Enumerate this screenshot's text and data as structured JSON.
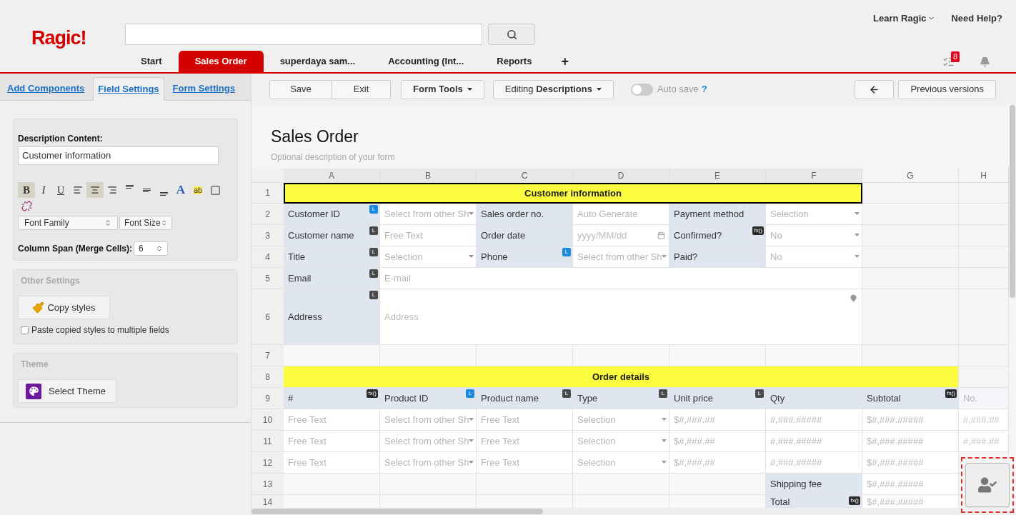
{
  "header": {
    "logo": "Ragic!",
    "links": [
      {
        "label": "Learn Ragic",
        "dropdown": true
      },
      {
        "label": "Need Help?",
        "dropdown": false
      }
    ],
    "task_count": "8"
  },
  "tabs": [
    {
      "label": "Start",
      "selected": false
    },
    {
      "label": "Sales Order",
      "selected": true
    },
    {
      "label": "superdaya sam...",
      "selected": false
    },
    {
      "label": "Accounting (Int...",
      "selected": false
    },
    {
      "label": "Reports",
      "selected": false
    }
  ],
  "add_tab": "+",
  "left_panel": {
    "tabs": [
      {
        "label": "Add Components",
        "selected": false
      },
      {
        "label": "Field Settings",
        "selected": true
      },
      {
        "label": "Form Settings",
        "selected": false
      }
    ],
    "description": {
      "label": "Description Content:",
      "value": "Customer information"
    },
    "format_buttons": [
      {
        "kind": "bold",
        "label": "B",
        "on": true
      },
      {
        "kind": "italic",
        "label": "I",
        "on": false
      },
      {
        "kind": "underline",
        "label": "U",
        "on": false
      },
      {
        "kind": "align-left",
        "on": false
      },
      {
        "kind": "align-center",
        "on": true
      },
      {
        "kind": "align-right",
        "on": false
      },
      {
        "kind": "valign-top",
        "on": false
      },
      {
        "kind": "valign-middle",
        "on": false
      },
      {
        "kind": "valign-bottom",
        "on": false
      },
      {
        "kind": "font-color",
        "label": "A",
        "on": false
      },
      {
        "kind": "highlight",
        "label": "ab",
        "on": false
      },
      {
        "kind": "border",
        "on": false
      },
      {
        "kind": "unlink",
        "on": false
      }
    ],
    "font_family": "Font Family",
    "font_size": "Font Size",
    "column_span": {
      "label": "Column Span (Merge Cells):",
      "value": "6"
    },
    "other_settings": {
      "title": "Other Settings",
      "button": "Copy styles",
      "paste": {
        "label": "Paste copied styles to multiple fields",
        "checked": false
      }
    },
    "theme": {
      "title": "Theme",
      "button": "Select Theme"
    }
  },
  "toolbar": {
    "save": "Save",
    "exit": "Exit",
    "form_tools": "Form Tools",
    "editing": "Editing **Descriptions**",
    "autosave": {
      "label": "Auto save",
      "on": false,
      "help": "?"
    },
    "versions": "Previous versions"
  },
  "form": {
    "title": "Sales Order",
    "description_placeholder": "Optional description of your form"
  },
  "sheet": {
    "columns": [
      "A",
      "B",
      "C",
      "D",
      "E",
      "F",
      "G",
      "H"
    ],
    "rows": [
      {
        "number": "1",
        "cells": [
          {
            "kind": "section",
            "text": "Customer information",
            "selected": true
          },
          {
            "kind": "empty"
          },
          {
            "kind": "empty"
          }
        ]
      },
      {
        "number": "2",
        "cells": [
          {
            "kind": "label",
            "text": "Customer ID",
            "badge": {
              "kind": "link",
              "text": "L"
            }
          },
          {
            "kind": "input",
            "placeholder": "Select from other Sh",
            "dropdown": true
          },
          {
            "kind": "label",
            "text": "Sales order no."
          },
          {
            "kind": "input",
            "placeholder": "Auto Generate",
            "dropdown": false
          },
          {
            "kind": "label",
            "text": "Payment method"
          },
          {
            "kind": "input",
            "placeholder": "Selection",
            "dropdown": true
          },
          {
            "kind": "empty"
          },
          {
            "kind": "empty"
          }
        ]
      },
      {
        "number": "3",
        "cells": [
          {
            "kind": "label",
            "text": "Customer name",
            "badge": {
              "kind": "plain",
              "text": "L"
            }
          },
          {
            "kind": "input",
            "placeholder": "Free Text",
            "dropdown": false
          },
          {
            "kind": "label",
            "text": "Order date"
          },
          {
            "kind": "date",
            "placeholder": "yyyy/MM/dd"
          },
          {
            "kind": "label",
            "text": "Confirmed?",
            "badge": {
              "kind": "formula",
              "text": "fx()"
            }
          },
          {
            "kind": "input",
            "placeholder": "No",
            "dropdown": true
          },
          {
            "kind": "empty"
          },
          {
            "kind": "empty"
          }
        ]
      },
      {
        "number": "4",
        "cells": [
          {
            "kind": "label",
            "text": "Title",
            "badge": {
              "kind": "plain",
              "text": "L"
            }
          },
          {
            "kind": "input",
            "placeholder": "Selection",
            "dropdown": true
          },
          {
            "kind": "label",
            "text": "Phone",
            "badge": {
              "kind": "link",
              "text": "L"
            }
          },
          {
            "kind": "input",
            "placeholder": "Select from other Sh",
            "dropdown": true
          },
          {
            "kind": "label",
            "text": "Paid?"
          },
          {
            "kind": "input",
            "placeholder": "No",
            "dropdown": true
          },
          {
            "kind": "empty"
          },
          {
            "kind": "empty"
          }
        ]
      },
      {
        "number": "5",
        "cells": [
          {
            "kind": "label",
            "text": "Email",
            "badge": {
              "kind": "plain",
              "text": "L"
            }
          },
          {
            "kind": "input",
            "placeholder": "E-mail",
            "dropdown": false
          },
          {
            "kind": "empty"
          },
          {
            "kind": "empty"
          }
        ]
      },
      {
        "number": "6",
        "cells": [
          {
            "kind": "label",
            "text": "Address",
            "badge": {
              "kind": "plain",
              "text": "L"
            }
          },
          {
            "kind": "address",
            "placeholder": "Address"
          },
          {
            "kind": "empty"
          },
          {
            "kind": "empty"
          }
        ]
      },
      {
        "number": "7",
        "cells": [
          {
            "kind": "empty"
          },
          {
            "kind": "empty"
          },
          {
            "kind": "empty"
          },
          {
            "kind": "empty"
          },
          {
            "kind": "empty"
          },
          {
            "kind": "empty"
          },
          {
            "kind": "empty"
          },
          {
            "kind": "empty"
          }
        ]
      },
      {
        "number": "8",
        "cells": [
          {
            "kind": "section",
            "text": "Order details",
            "selected": false
          },
          {
            "kind": "empty"
          }
        ]
      },
      {
        "number": "9",
        "cells": [
          {
            "kind": "label",
            "text": "#",
            "badge": {
              "kind": "formula",
              "text": "fx()"
            }
          },
          {
            "kind": "label",
            "text": "Product ID",
            "badge": {
              "kind": "link",
              "text": "L"
            }
          },
          {
            "kind": "label",
            "text": "Product name",
            "badge": {
              "kind": "plain",
              "text": "L"
            }
          },
          {
            "kind": "label",
            "text": "Type",
            "badge": {
              "kind": "plain",
              "text": "L"
            }
          },
          {
            "kind": "label",
            "text": "Unit price",
            "badge": {
              "kind": "plain",
              "text": "L"
            }
          },
          {
            "kind": "label",
            "text": "Qty"
          },
          {
            "kind": "label",
            "text": "Subtotal",
            "badge": {
              "kind": "formula",
              "text": "fx()"
            }
          },
          {
            "kind": "label",
            "text": "No.",
            "dim": true
          }
        ]
      },
      {
        "number": "10",
        "cells": [
          {
            "kind": "input",
            "placeholder": "Free Text",
            "dropdown": false
          },
          {
            "kind": "input",
            "placeholder": "Select from other Sh",
            "dropdown": true
          },
          {
            "kind": "input",
            "placeholder": "Free Text",
            "dropdown": false
          },
          {
            "kind": "input",
            "placeholder": "Selection",
            "dropdown": true
          },
          {
            "kind": "input",
            "placeholder": "$#,###.##",
            "dropdown": false
          },
          {
            "kind": "input",
            "placeholder": "#,###.#####",
            "dropdown": false
          },
          {
            "kind": "input",
            "placeholder": "$#,###.#####",
            "dropdown": false
          },
          {
            "kind": "input",
            "placeholder": "#,###.##",
            "dropdown": false,
            "dim": true
          }
        ]
      },
      {
        "number": "11",
        "cells": [
          {
            "kind": "input",
            "placeholder": "Free Text",
            "dropdown": false
          },
          {
            "kind": "input",
            "placeholder": "Select from other Sh",
            "dropdown": true
          },
          {
            "kind": "input",
            "placeholder": "Free Text",
            "dropdown": false
          },
          {
            "kind": "input",
            "placeholder": "Selection",
            "dropdown": true
          },
          {
            "kind": "input",
            "placeholder": "$#,###.##",
            "dropdown": false
          },
          {
            "kind": "input",
            "placeholder": "#,###.#####",
            "dropdown": false
          },
          {
            "kind": "input",
            "placeholder": "$#,###.#####",
            "dropdown": false
          },
          {
            "kind": "input",
            "placeholder": "#,###.##",
            "dropdown": false,
            "dim": true
          }
        ]
      },
      {
        "number": "12",
        "cells": [
          {
            "kind": "input",
            "placeholder": "Free Text",
            "dropdown": false
          },
          {
            "kind": "input",
            "placeholder": "Select from other Sh",
            "dropdown": true
          },
          {
            "kind": "input",
            "placeholder": "Free Text",
            "dropdown": false
          },
          {
            "kind": "input",
            "placeholder": "Selection",
            "dropdown": true
          },
          {
            "kind": "input",
            "placeholder": "$#,###.##",
            "dropdown": false
          },
          {
            "kind": "input",
            "placeholder": "#,###.#####",
            "dropdown": false
          },
          {
            "kind": "input",
            "placeholder": "$#,###.#####",
            "dropdown": false
          },
          {
            "kind": "empty"
          }
        ]
      },
      {
        "number": "13",
        "cells": [
          {
            "kind": "empty"
          },
          {
            "kind": "empty"
          },
          {
            "kind": "empty"
          },
          {
            "kind": "empty"
          },
          {
            "kind": "empty"
          },
          {
            "kind": "label",
            "text": "Shipping fee"
          },
          {
            "kind": "input",
            "placeholder": "$#,###.#####",
            "dropdown": false
          },
          {
            "kind": "empty"
          }
        ]
      },
      {
        "number": "14",
        "cells": [
          {
            "kind": "empty"
          },
          {
            "kind": "empty"
          },
          {
            "kind": "empty"
          },
          {
            "kind": "empty"
          },
          {
            "kind": "empty"
          },
          {
            "kind": "label",
            "text": "Total",
            "badge": {
              "kind": "formula",
              "text": "fx()"
            }
          },
          {
            "kind": "input",
            "placeholder": "$#,###.#####",
            "dropdown": false
          }
        ]
      }
    ]
  }
}
